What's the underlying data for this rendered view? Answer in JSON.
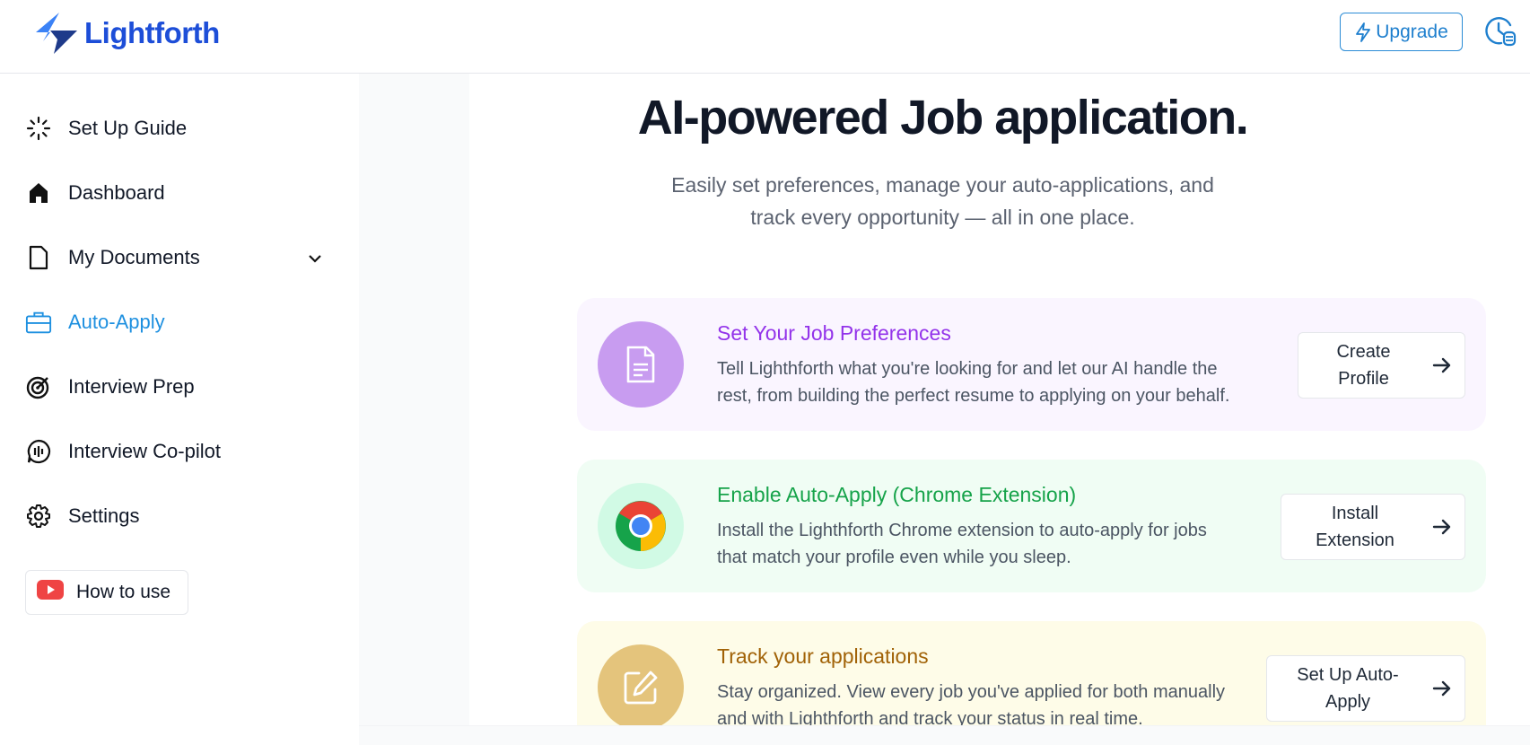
{
  "header": {
    "brand": "Lightforth",
    "upgrade_label": "Upgrade"
  },
  "sidebar": {
    "items": [
      {
        "label": "Set Up Guide",
        "icon": "loader-icon"
      },
      {
        "label": "Dashboard",
        "icon": "home-icon"
      },
      {
        "label": "My Documents",
        "icon": "document-icon"
      },
      {
        "label": "Auto-Apply",
        "icon": "briefcase-icon",
        "active": true
      },
      {
        "label": "Interview Prep",
        "icon": "target-icon"
      },
      {
        "label": "Interview Co-pilot",
        "icon": "audio-icon"
      },
      {
        "label": "Settings",
        "icon": "gear-icon"
      }
    ],
    "how_to_use": "How to use"
  },
  "hero": {
    "title": "AI-powered Job application.",
    "subtitle_line1": "Easily set preferences, manage your auto-applications, and",
    "subtitle_line2": "track every opportunity — all in one place."
  },
  "cards": [
    {
      "title": "Set Your Job Preferences",
      "desc_line1": "Tell Lighthforth what you're looking for and let our AI handle the",
      "desc_line2": "rest, from building the perfect resume to applying on your behalf.",
      "action_line1": "Create",
      "action_line2": "Profile",
      "icon": "file-text-icon"
    },
    {
      "title": "Enable Auto-Apply (Chrome Extension)",
      "desc_line1": "Install the Lighthforth Chrome extension to auto-apply for jobs",
      "desc_line2": "that match your profile even while you sleep.",
      "action_line1": "Install",
      "action_line2": "Extension",
      "icon": "chrome-icon"
    },
    {
      "title": "Track your applications",
      "desc_line1": "Stay organized. View every job you've applied for both manually",
      "desc_line2": "and with Lighthforth and track your status in real time.",
      "action_line1": "Set Up Auto-",
      "action_line2": "Apply",
      "icon": "edit-icon"
    }
  ],
  "colors": {
    "brand": "#1d4ed8",
    "accent": "#1e90e0",
    "purple": "#9333ea",
    "green": "#16a34a",
    "amber": "#a16207"
  }
}
